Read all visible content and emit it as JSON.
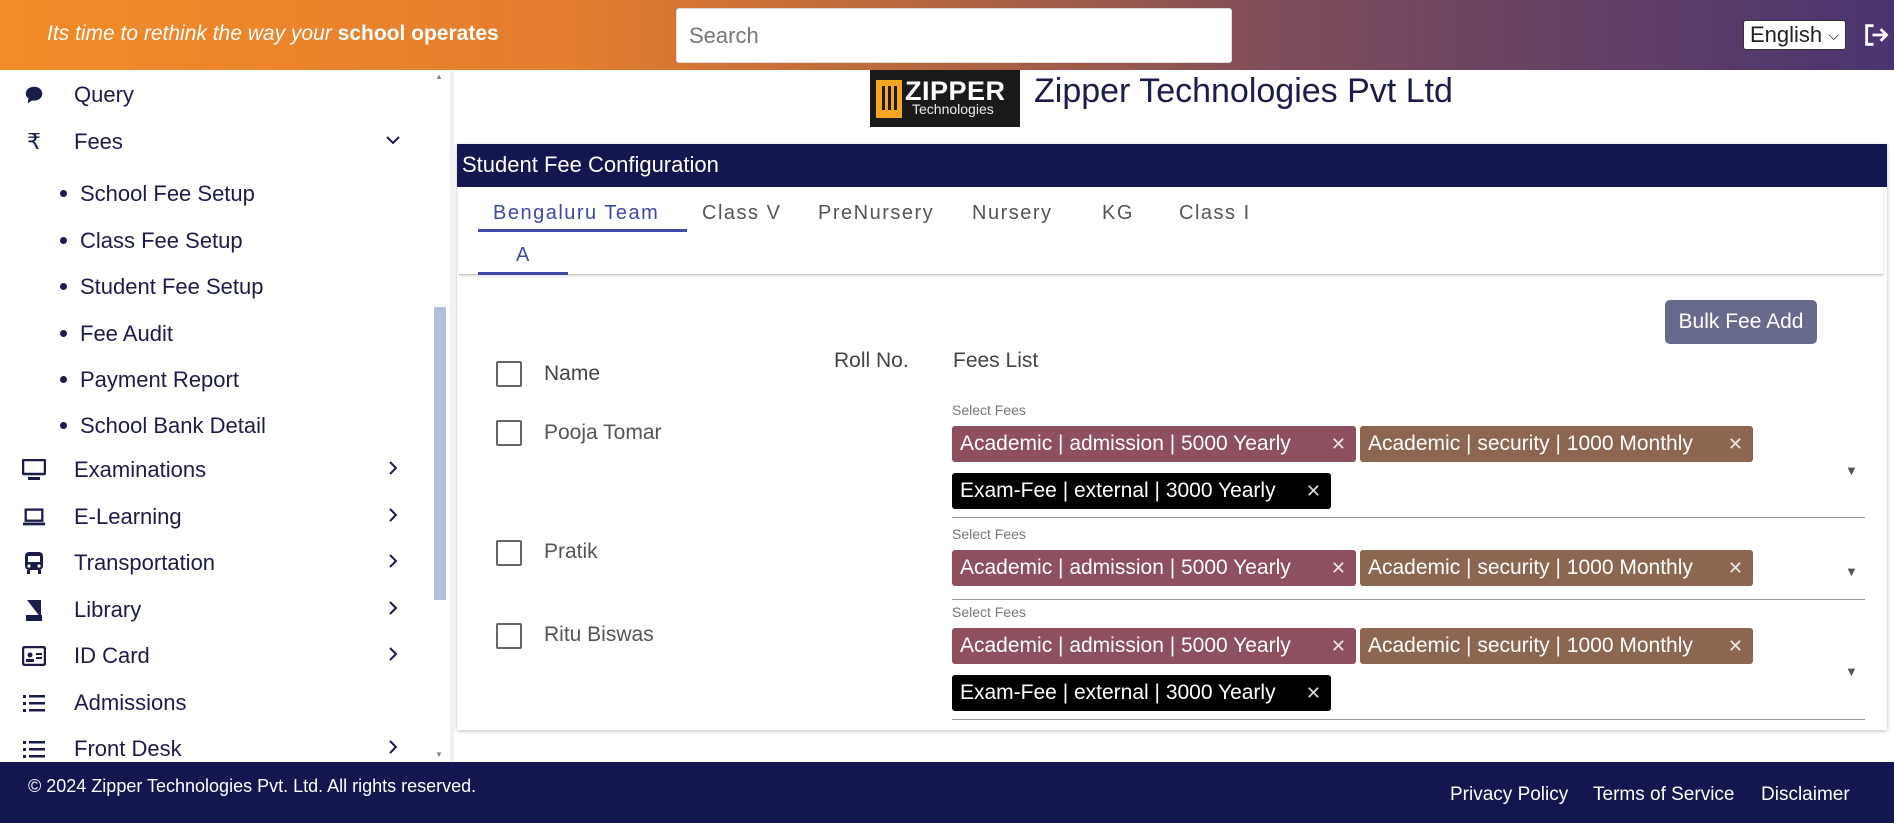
{
  "header": {
    "tagline_prefix": "Its time to rethink the way your",
    "tagline_bold": "school operates",
    "search_placeholder": "Search",
    "language": "English",
    "logout_icon": "logout-icon"
  },
  "sidebar": {
    "items": [
      {
        "label": "Query",
        "icon": "chat-icon",
        "arrow": ""
      },
      {
        "label": "Fees",
        "icon": "rupee-icon",
        "arrow": "chevron-down"
      },
      {
        "label": "Examinations",
        "icon": "monitor-icon",
        "arrow": "chevron-right"
      },
      {
        "label": "E-Learning",
        "icon": "laptop-icon",
        "arrow": "chevron-right"
      },
      {
        "label": "Transportation",
        "icon": "bus-icon",
        "arrow": "chevron-right"
      },
      {
        "label": "Library",
        "icon": "book-icon",
        "arrow": "chevron-right"
      },
      {
        "label": "ID Card",
        "icon": "id-card-icon",
        "arrow": "chevron-right"
      },
      {
        "label": "Admissions",
        "icon": "list-icon",
        "arrow": ""
      },
      {
        "label": "Front Desk",
        "icon": "list-icon",
        "arrow": "chevron-right"
      }
    ],
    "fees_sub": [
      "School Fee Setup",
      "Class Fee Setup",
      "Student Fee Setup",
      "Fee Audit",
      "Payment Report",
      "School Bank Detail"
    ]
  },
  "brand": {
    "logo_text": "ZIPPER",
    "logo_sub": "Technologies",
    "company": "Zipper Technologies Pvt Ltd"
  },
  "main": {
    "card_title": "Student Fee Configuration",
    "tabs": [
      "Bengaluru Team",
      "Class V",
      "PreNursery",
      "Nursery",
      "KG",
      "Class I"
    ],
    "section_tabs": [
      "A"
    ],
    "bulk_button": "Bulk Fee Add",
    "columns": {
      "name": "Name",
      "roll": "Roll No.",
      "fees": "Fees List"
    },
    "select_label": "Select Fees",
    "students": [
      {
        "name": "Pooja Tomar",
        "fees": [
          "Academic | admission | 5000 Yearly",
          "Academic | security | 1000 Monthly",
          "Exam-Fee | external | 3000 Yearly"
        ]
      },
      {
        "name": "Pratik",
        "fees": [
          "Academic | admission | 5000 Yearly",
          "Academic | security | 1000 Monthly"
        ]
      },
      {
        "name": "Ritu Biswas",
        "fees": [
          "Academic | admission | 5000 Yearly",
          "Academic | security | 1000 Monthly",
          "Exam-Fee | external | 3000 Yearly"
        ]
      }
    ],
    "chip_colors": {
      "admission": "#8e4f5e",
      "security": "#8c6650",
      "exam": "#000000"
    }
  },
  "footer": {
    "copyright": "© 2024 Zipper Technologies Pvt. Ltd. All rights reserved.",
    "links": [
      "Privacy Policy",
      "Terms of Service",
      "Disclaimer"
    ]
  }
}
